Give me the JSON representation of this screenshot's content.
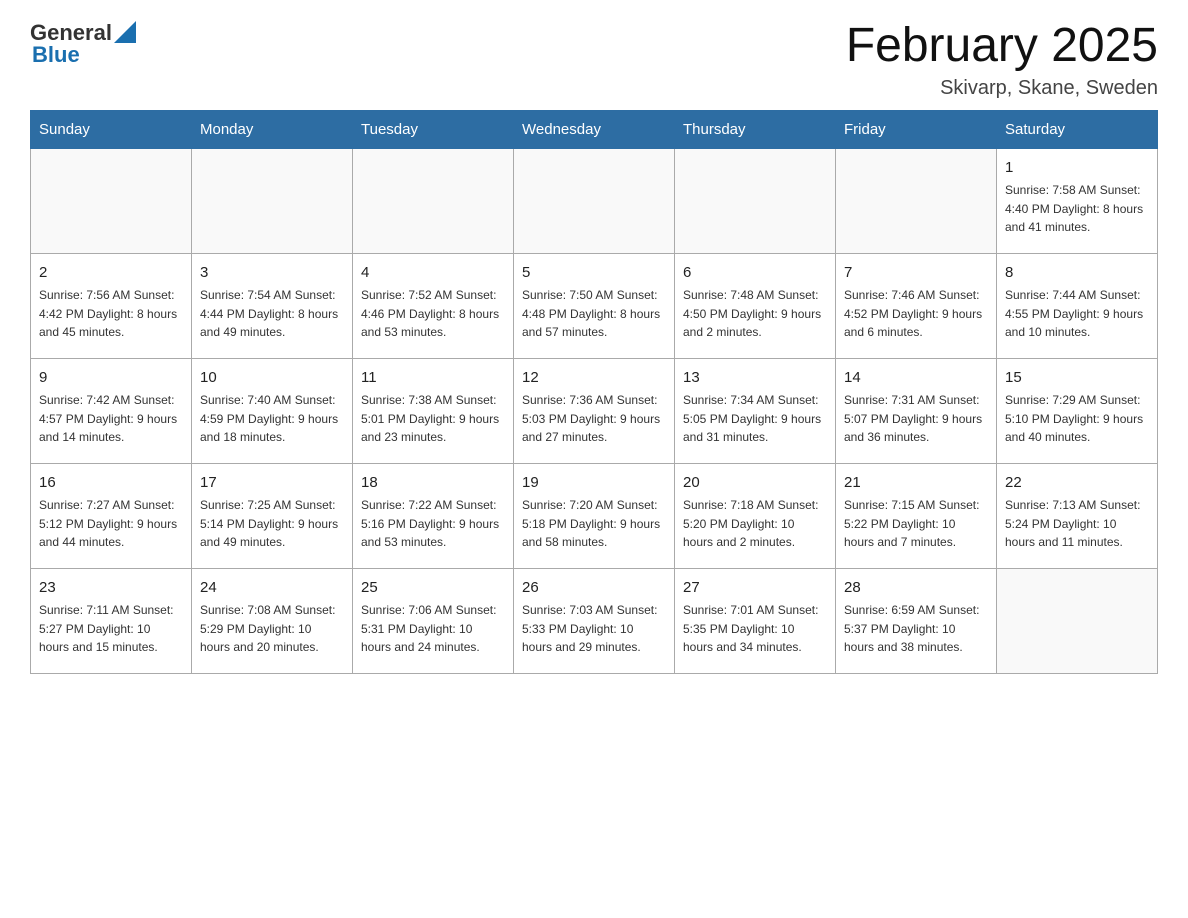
{
  "logo": {
    "text_general": "General",
    "text_blue": "Blue"
  },
  "title": "February 2025",
  "subtitle": "Skivarp, Skane, Sweden",
  "weekdays": [
    "Sunday",
    "Monday",
    "Tuesday",
    "Wednesday",
    "Thursday",
    "Friday",
    "Saturday"
  ],
  "weeks": [
    [
      {
        "day": "",
        "info": ""
      },
      {
        "day": "",
        "info": ""
      },
      {
        "day": "",
        "info": ""
      },
      {
        "day": "",
        "info": ""
      },
      {
        "day": "",
        "info": ""
      },
      {
        "day": "",
        "info": ""
      },
      {
        "day": "1",
        "info": "Sunrise: 7:58 AM\nSunset: 4:40 PM\nDaylight: 8 hours\nand 41 minutes."
      }
    ],
    [
      {
        "day": "2",
        "info": "Sunrise: 7:56 AM\nSunset: 4:42 PM\nDaylight: 8 hours\nand 45 minutes."
      },
      {
        "day": "3",
        "info": "Sunrise: 7:54 AM\nSunset: 4:44 PM\nDaylight: 8 hours\nand 49 minutes."
      },
      {
        "day": "4",
        "info": "Sunrise: 7:52 AM\nSunset: 4:46 PM\nDaylight: 8 hours\nand 53 minutes."
      },
      {
        "day": "5",
        "info": "Sunrise: 7:50 AM\nSunset: 4:48 PM\nDaylight: 8 hours\nand 57 minutes."
      },
      {
        "day": "6",
        "info": "Sunrise: 7:48 AM\nSunset: 4:50 PM\nDaylight: 9 hours\nand 2 minutes."
      },
      {
        "day": "7",
        "info": "Sunrise: 7:46 AM\nSunset: 4:52 PM\nDaylight: 9 hours\nand 6 minutes."
      },
      {
        "day": "8",
        "info": "Sunrise: 7:44 AM\nSunset: 4:55 PM\nDaylight: 9 hours\nand 10 minutes."
      }
    ],
    [
      {
        "day": "9",
        "info": "Sunrise: 7:42 AM\nSunset: 4:57 PM\nDaylight: 9 hours\nand 14 minutes."
      },
      {
        "day": "10",
        "info": "Sunrise: 7:40 AM\nSunset: 4:59 PM\nDaylight: 9 hours\nand 18 minutes."
      },
      {
        "day": "11",
        "info": "Sunrise: 7:38 AM\nSunset: 5:01 PM\nDaylight: 9 hours\nand 23 minutes."
      },
      {
        "day": "12",
        "info": "Sunrise: 7:36 AM\nSunset: 5:03 PM\nDaylight: 9 hours\nand 27 minutes."
      },
      {
        "day": "13",
        "info": "Sunrise: 7:34 AM\nSunset: 5:05 PM\nDaylight: 9 hours\nand 31 minutes."
      },
      {
        "day": "14",
        "info": "Sunrise: 7:31 AM\nSunset: 5:07 PM\nDaylight: 9 hours\nand 36 minutes."
      },
      {
        "day": "15",
        "info": "Sunrise: 7:29 AM\nSunset: 5:10 PM\nDaylight: 9 hours\nand 40 minutes."
      }
    ],
    [
      {
        "day": "16",
        "info": "Sunrise: 7:27 AM\nSunset: 5:12 PM\nDaylight: 9 hours\nand 44 minutes."
      },
      {
        "day": "17",
        "info": "Sunrise: 7:25 AM\nSunset: 5:14 PM\nDaylight: 9 hours\nand 49 minutes."
      },
      {
        "day": "18",
        "info": "Sunrise: 7:22 AM\nSunset: 5:16 PM\nDaylight: 9 hours\nand 53 minutes."
      },
      {
        "day": "19",
        "info": "Sunrise: 7:20 AM\nSunset: 5:18 PM\nDaylight: 9 hours\nand 58 minutes."
      },
      {
        "day": "20",
        "info": "Sunrise: 7:18 AM\nSunset: 5:20 PM\nDaylight: 10 hours\nand 2 minutes."
      },
      {
        "day": "21",
        "info": "Sunrise: 7:15 AM\nSunset: 5:22 PM\nDaylight: 10 hours\nand 7 minutes."
      },
      {
        "day": "22",
        "info": "Sunrise: 7:13 AM\nSunset: 5:24 PM\nDaylight: 10 hours\nand 11 minutes."
      }
    ],
    [
      {
        "day": "23",
        "info": "Sunrise: 7:11 AM\nSunset: 5:27 PM\nDaylight: 10 hours\nand 15 minutes."
      },
      {
        "day": "24",
        "info": "Sunrise: 7:08 AM\nSunset: 5:29 PM\nDaylight: 10 hours\nand 20 minutes."
      },
      {
        "day": "25",
        "info": "Sunrise: 7:06 AM\nSunset: 5:31 PM\nDaylight: 10 hours\nand 24 minutes."
      },
      {
        "day": "26",
        "info": "Sunrise: 7:03 AM\nSunset: 5:33 PM\nDaylight: 10 hours\nand 29 minutes."
      },
      {
        "day": "27",
        "info": "Sunrise: 7:01 AM\nSunset: 5:35 PM\nDaylight: 10 hours\nand 34 minutes."
      },
      {
        "day": "28",
        "info": "Sunrise: 6:59 AM\nSunset: 5:37 PM\nDaylight: 10 hours\nand 38 minutes."
      },
      {
        "day": "",
        "info": ""
      }
    ]
  ]
}
